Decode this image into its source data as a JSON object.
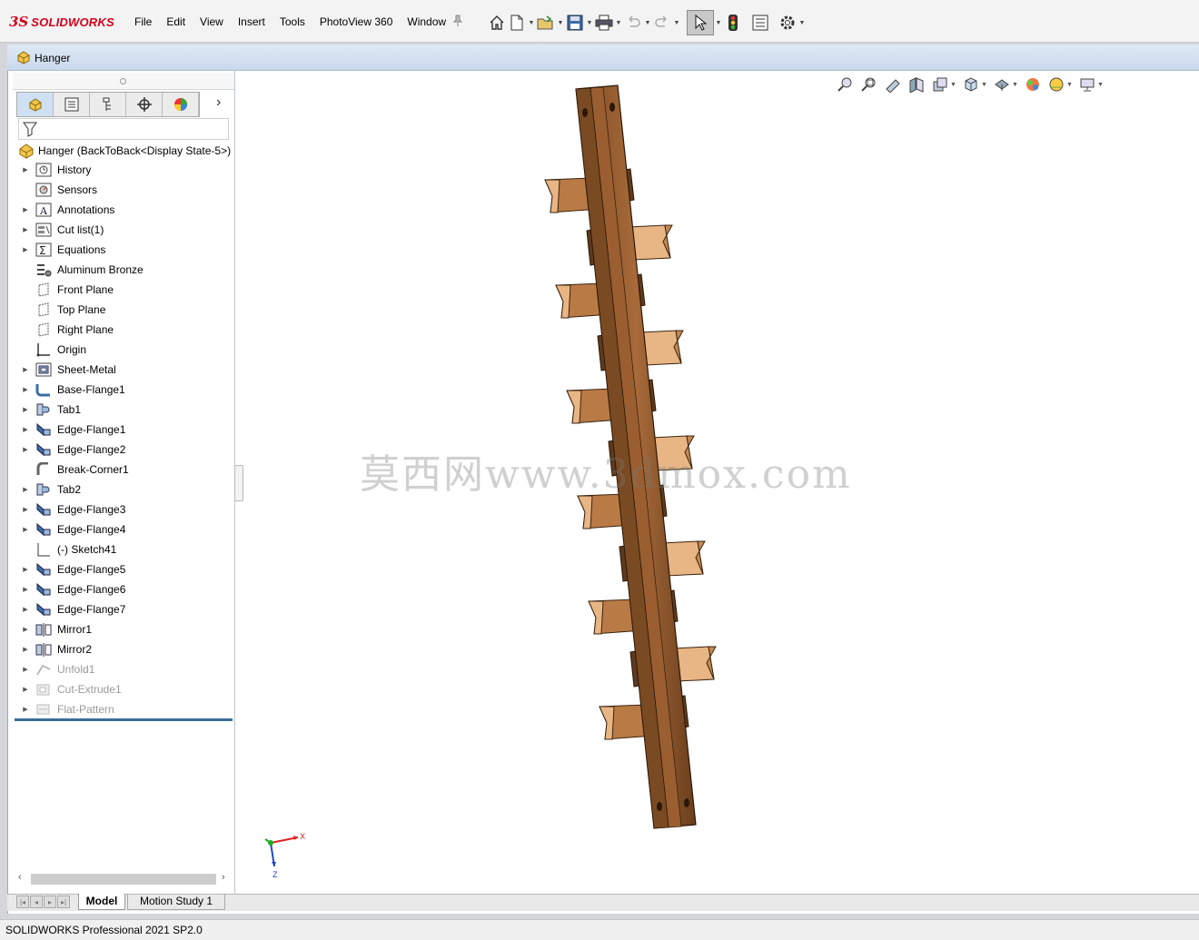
{
  "app": {
    "brand_prefix": "3S",
    "brand_name": "SOLIDWORKS"
  },
  "menu": [
    "File",
    "Edit",
    "View",
    "Insert",
    "Tools",
    "PhotoView 360",
    "Window"
  ],
  "toolbar_icons": [
    "home-icon",
    "new-document-icon",
    "open-icon",
    "save-icon",
    "print-icon",
    "undo-icon",
    "redo-icon",
    "select-pointer-icon",
    "rebuild-icon",
    "file-properties-icon",
    "options-gear-icon"
  ],
  "document": {
    "title": "Hanger"
  },
  "feature_manager": {
    "root_label": "Hanger  (BackToBack<Display State-5>)",
    "items": [
      {
        "label": "History",
        "icon": "history-icon",
        "expandable": true,
        "dim": false
      },
      {
        "label": "Sensors",
        "icon": "sensors-icon",
        "expandable": false,
        "dim": false
      },
      {
        "label": "Annotations",
        "icon": "annotations-icon",
        "expandable": true,
        "dim": false
      },
      {
        "label": "Cut list(1)",
        "icon": "cut-list-icon",
        "expandable": true,
        "dim": false
      },
      {
        "label": "Equations",
        "icon": "equations-icon",
        "expandable": true,
        "dim": false
      },
      {
        "label": "Aluminum Bronze",
        "icon": "material-icon",
        "expandable": false,
        "dim": false
      },
      {
        "label": "Front Plane",
        "icon": "plane-icon",
        "expandable": false,
        "dim": false
      },
      {
        "label": "Top Plane",
        "icon": "plane-icon",
        "expandable": false,
        "dim": false
      },
      {
        "label": "Right Plane",
        "icon": "plane-icon",
        "expandable": false,
        "dim": false
      },
      {
        "label": "Origin",
        "icon": "origin-icon",
        "expandable": false,
        "dim": false
      },
      {
        "label": "Sheet-Metal",
        "icon": "sheet-metal-icon",
        "expandable": true,
        "dim": false
      },
      {
        "label": "Base-Flange1",
        "icon": "base-flange-icon",
        "expandable": true,
        "dim": false
      },
      {
        "label": "Tab1",
        "icon": "tab-icon",
        "expandable": true,
        "dim": false
      },
      {
        "label": "Edge-Flange1",
        "icon": "edge-flange-icon",
        "expandable": true,
        "dim": false
      },
      {
        "label": "Edge-Flange2",
        "icon": "edge-flange-icon",
        "expandable": true,
        "dim": false
      },
      {
        "label": "Break-Corner1",
        "icon": "break-corner-icon",
        "expandable": false,
        "dim": false
      },
      {
        "label": "Tab2",
        "icon": "tab-icon",
        "expandable": true,
        "dim": false
      },
      {
        "label": "Edge-Flange3",
        "icon": "edge-flange-icon",
        "expandable": true,
        "dim": false
      },
      {
        "label": "Edge-Flange4",
        "icon": "edge-flange-icon",
        "expandable": true,
        "dim": false
      },
      {
        "label": "(-) Sketch41",
        "icon": "sketch-icon",
        "expandable": false,
        "dim": false
      },
      {
        "label": "Edge-Flange5",
        "icon": "edge-flange-icon",
        "expandable": true,
        "dim": false
      },
      {
        "label": "Edge-Flange6",
        "icon": "edge-flange-icon",
        "expandable": true,
        "dim": false
      },
      {
        "label": "Edge-Flange7",
        "icon": "edge-flange-icon",
        "expandable": true,
        "dim": false
      },
      {
        "label": "Mirror1",
        "icon": "mirror-icon",
        "expandable": true,
        "dim": false
      },
      {
        "label": "Mirror2",
        "icon": "mirror-icon",
        "expandable": true,
        "dim": false
      },
      {
        "label": "Unfold1",
        "icon": "unfold-icon",
        "expandable": true,
        "dim": true
      },
      {
        "label": "Cut-Extrude1",
        "icon": "cut-extrude-icon",
        "expandable": true,
        "dim": true
      },
      {
        "label": "Flat-Pattern",
        "icon": "flat-pattern-icon",
        "expandable": true,
        "dim": true
      }
    ]
  },
  "viewport": {
    "watermark": "莫西网www.3dmox.com",
    "triad_x": "X",
    "triad_z": "Z"
  },
  "bottom_tabs": {
    "model": "Model",
    "motion": "Motion Study 1"
  },
  "status": {
    "text": "SOLIDWORKS Professional 2021 SP2.0"
  },
  "colors": {
    "part_face": "#a86a3a",
    "part_dark": "#5e3a1e",
    "part_light": "#e8b584",
    "accent_red": "#d6001c",
    "rollback_bar": "#3b6e9a"
  }
}
